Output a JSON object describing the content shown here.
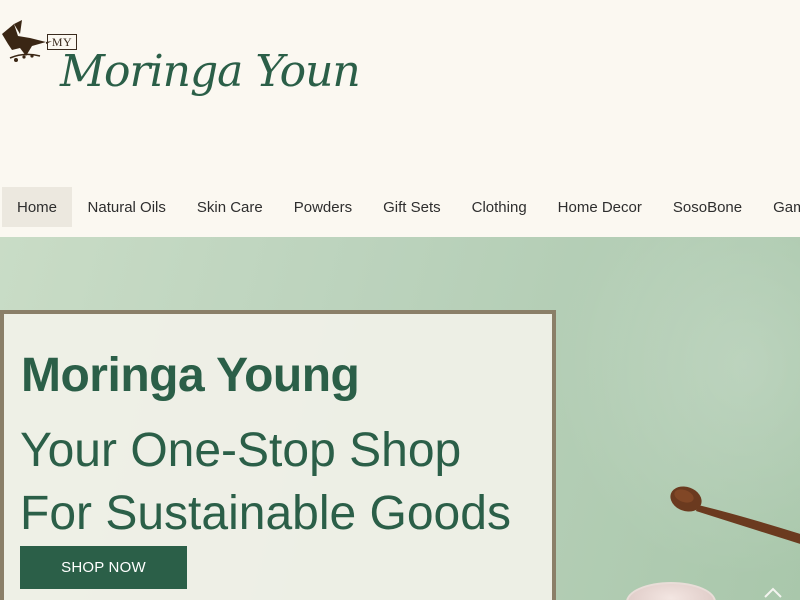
{
  "logo": {
    "badge": "MY",
    "script_text": "Moringa Young",
    "icon": "hummingbird-icon"
  },
  "nav": {
    "items": [
      {
        "label": "Home",
        "active": true
      },
      {
        "label": "Natural Oils"
      },
      {
        "label": "Skin Care"
      },
      {
        "label": "Powders"
      },
      {
        "label": "Gift Sets"
      },
      {
        "label": "Clothing"
      },
      {
        "label": "Home Decor"
      },
      {
        "label": "SosoBone"
      },
      {
        "label": "Gam"
      }
    ]
  },
  "hero": {
    "title": "Moringa Young",
    "tagline_line1": "Your One-Stop Shop",
    "tagline_line2": "For Sustainable Goods",
    "cta_label": "SHOP NOW"
  },
  "colors": {
    "brand_green": "#2b5f48",
    "background": "#fbf8f1",
    "hero_bg": "#bcd3bd",
    "card_border": "#8a7f68",
    "nav_active": "#ece8df"
  }
}
